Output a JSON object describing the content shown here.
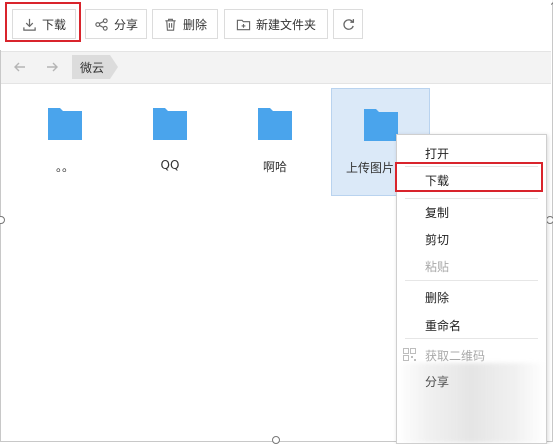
{
  "toolbar": {
    "download_label": "下载",
    "share_label": "分享",
    "delete_label": "删除",
    "new_folder_label": "新建文件夹"
  },
  "nav": {
    "breadcrumb": "微云"
  },
  "files": [
    {
      "name": "。。",
      "selected": false
    },
    {
      "name": "QQ",
      "selected": false
    },
    {
      "name": "啊哈",
      "selected": false
    },
    {
      "name": "上传图片",
      "selected": true
    }
  ],
  "context_menu": {
    "items": [
      "打开",
      "下载",
      "复制",
      "剪切",
      "粘贴",
      "删除",
      "重命名",
      "获取二维码",
      "分享"
    ],
    "disabled": [
      "粘贴",
      "获取二维码"
    ],
    "highlighted": "下载"
  },
  "colors": {
    "folder": "#4aa4ec",
    "highlight": "#d9242c",
    "selection": "#dbe9f8"
  }
}
